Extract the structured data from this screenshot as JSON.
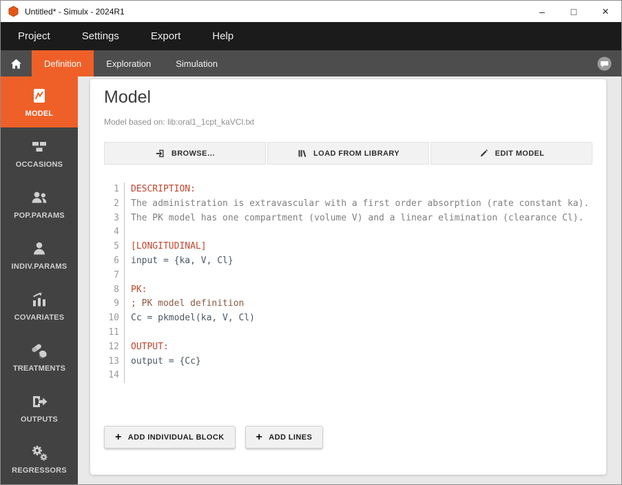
{
  "window": {
    "title": "Untitled* - Simulx - 2024R1",
    "controls": {
      "minimize": "–",
      "maximize": "□",
      "close": "×"
    }
  },
  "menubar": {
    "items": [
      {
        "label": "Project"
      },
      {
        "label": "Settings"
      },
      {
        "label": "Export"
      },
      {
        "label": "Help"
      }
    ]
  },
  "tabbar": {
    "tabs": [
      {
        "label": "Definition",
        "active": true
      },
      {
        "label": "Exploration",
        "active": false
      },
      {
        "label": "Simulation",
        "active": false
      }
    ]
  },
  "sidebar": {
    "items": [
      {
        "label": "MODEL",
        "icon": "model-icon",
        "active": true
      },
      {
        "label": "OCCASIONS",
        "icon": "occasions-icon",
        "active": false
      },
      {
        "label": "POP.PARAMS",
        "icon": "population-icon",
        "active": false
      },
      {
        "label": "INDIV.PARAMS",
        "icon": "individual-icon",
        "active": false
      },
      {
        "label": "COVARIATES",
        "icon": "covariates-icon",
        "active": false
      },
      {
        "label": "TREATMENTS",
        "icon": "pills-icon",
        "active": false
      },
      {
        "label": "OUTPUTS",
        "icon": "output-arrow-icon",
        "active": false
      },
      {
        "label": "REGRESSORS",
        "icon": "gears-icon",
        "active": false
      }
    ]
  },
  "main": {
    "title": "Model",
    "based_on": "Model based on: lib:oral1_1cpt_kaVCl.txt",
    "toolbar": {
      "browse": "BROWSE…",
      "load_library": "LOAD FROM LIBRARY",
      "edit_model": "EDIT MODEL"
    },
    "code": {
      "lines": [
        {
          "n": "1",
          "kind": "section",
          "text": "DESCRIPTION:"
        },
        {
          "n": "2",
          "kind": "text",
          "text": "The administration is extravascular with a first order absorption (rate constant ka)."
        },
        {
          "n": "3",
          "kind": "text",
          "text": "The PK model has one compartment (volume V) and a linear elimination (clearance Cl)."
        },
        {
          "n": "4",
          "kind": "blank",
          "text": ""
        },
        {
          "n": "5",
          "kind": "section",
          "text": "[LONGITUDINAL]"
        },
        {
          "n": "6",
          "kind": "code",
          "text": "input = {ka, V, Cl}"
        },
        {
          "n": "7",
          "kind": "blank",
          "text": ""
        },
        {
          "n": "8",
          "kind": "section",
          "text": "PK:"
        },
        {
          "n": "9",
          "kind": "comment",
          "text": "; PK model definition"
        },
        {
          "n": "10",
          "kind": "code",
          "text": "Cc = pkmodel(ka, V, Cl)"
        },
        {
          "n": "11",
          "kind": "blank",
          "text": ""
        },
        {
          "n": "12",
          "kind": "section",
          "text": "OUTPUT:"
        },
        {
          "n": "13",
          "kind": "code",
          "text": "output = {Cc}"
        },
        {
          "n": "14",
          "kind": "blank",
          "text": ""
        }
      ]
    },
    "actions": {
      "add_individual_block": "ADD INDIVIDUAL BLOCK",
      "add_lines": "ADD LINES"
    }
  },
  "colors": {
    "accent": "#ee6028",
    "menubar_bg": "#1b1b1b",
    "tabbar_bg": "#4d4d4d",
    "sidebar_bg": "#424242",
    "keyword": "#c2452e"
  }
}
